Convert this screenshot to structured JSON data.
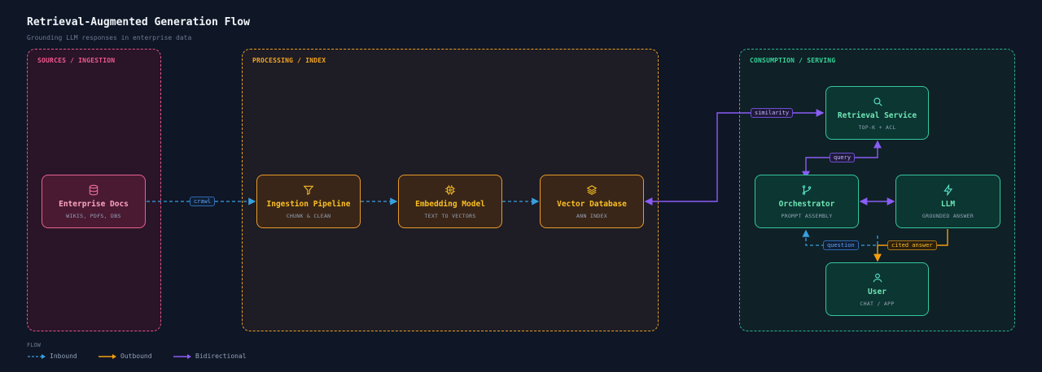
{
  "title": "Retrieval-Augmented Generation Flow",
  "subtitle": "Grounding LLM responses in enterprise data",
  "groups": {
    "sources": "SOURCES / INGESTION",
    "processing": "PROCESSING / INDEX",
    "consumption": "CONSUMPTION / SERVING"
  },
  "nodes": {
    "enterprise_docs": {
      "title": "Enterprise Docs",
      "sub": "WIKIS, PDFS, DBS",
      "icon": "database-icon"
    },
    "ingestion": {
      "title": "Ingestion Pipeline",
      "sub": "CHUNK & CLEAN",
      "icon": "filter-icon"
    },
    "embedding": {
      "title": "Embedding Model",
      "sub": "TEXT TO VECTORS",
      "icon": "chip-icon"
    },
    "vector_db": {
      "title": "Vector Database",
      "sub": "ANN INDEX",
      "icon": "layers-icon"
    },
    "retrieval": {
      "title": "Retrieval Service",
      "sub": "TOP-K + ACL",
      "icon": "search-icon"
    },
    "orchestrator": {
      "title": "Orchestrator",
      "sub": "PROMPT ASSEMBLY",
      "icon": "branch-icon"
    },
    "llm": {
      "title": "LLM",
      "sub": "GROUNDED ANSWER",
      "icon": "bolt-icon"
    },
    "user": {
      "title": "User",
      "sub": "CHAT / APP",
      "icon": "user-icon"
    }
  },
  "edges": {
    "crawl": "crawl",
    "similarity": "similarity",
    "query": "query",
    "question": "question",
    "cited_answer": "cited answer"
  },
  "legend": {
    "title": "FLOW",
    "inbound": "Inbound",
    "outbound": "Outbound",
    "bidirectional": "Bidirectional"
  },
  "colors": {
    "inbound": "#38a0e0",
    "outbound": "#f59e0b",
    "bidirectional": "#8b5cf6"
  }
}
